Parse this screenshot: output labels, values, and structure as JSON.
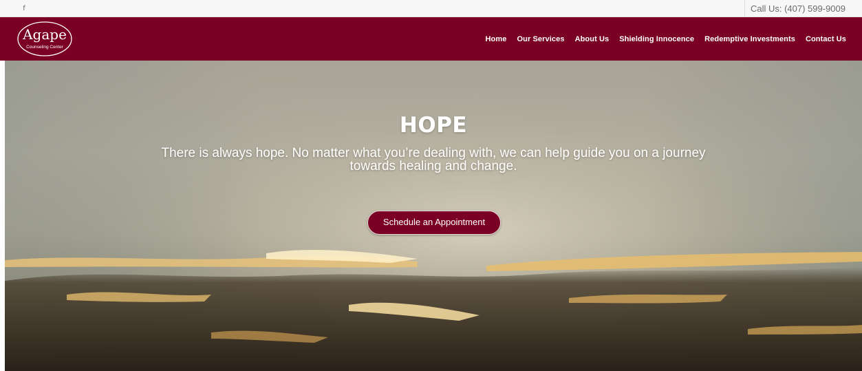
{
  "topbar": {
    "social_icon": "facebook-icon",
    "social_glyph": "f",
    "call_text": "Call Us: (407) 599-9009"
  },
  "header": {
    "logo_text": "Agape",
    "logo_subtext": "Counseling Center",
    "nav": [
      {
        "label": "Home"
      },
      {
        "label": "Our Services"
      },
      {
        "label": "About Us"
      },
      {
        "label": "Shielding Innocence"
      },
      {
        "label": "Redemptive Investments"
      },
      {
        "label": "Contact Us"
      }
    ]
  },
  "hero": {
    "title": "HOPE",
    "subtitle": "There is always hope. No matter what you’re dealing with, we can help guide you on a journey towards healing and change.",
    "cta_label": "Schedule an Appointment"
  },
  "colors": {
    "brand": "#7b0026",
    "topbar_bg": "#f7f7f7",
    "text_white": "#ffffff"
  }
}
